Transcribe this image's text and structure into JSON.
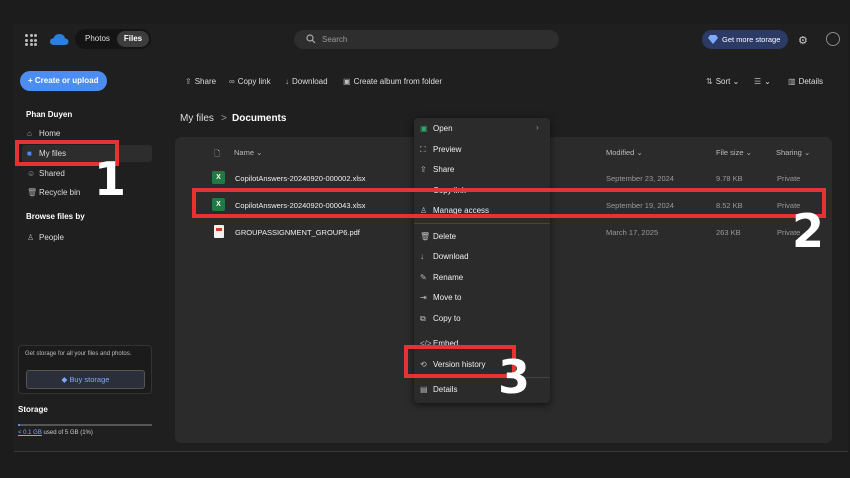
{
  "topbar": {
    "tab_photos": "Photos",
    "tab_files": "Files",
    "search_placeholder": "Search",
    "more_storage": "Get more storage",
    "icons": [
      "app-launcher-icon",
      "onedrive-cloud-icon",
      "search-icon",
      "diamond-icon",
      "gear-icon"
    ],
    "accent": "#4b8df0"
  },
  "sidebar": {
    "create_label": "Create or upload",
    "user_name": "Phan Duyen",
    "items": [
      {
        "label": "Home",
        "icon": "home-icon"
      },
      {
        "label": "My files",
        "icon": "folder-icon",
        "active": true
      },
      {
        "label": "Shared",
        "icon": "shared-people-icon"
      },
      {
        "label": "Recycle bin",
        "icon": "trash-icon"
      }
    ],
    "browse_heading": "Browse files by",
    "browse_items": [
      {
        "label": "People",
        "icon": "person-icon"
      }
    ],
    "promo_text": "Get storage for all your files and photos.",
    "buy_storage": "Buy storage",
    "storage_title": "Storage",
    "storage_used_link": "< 0.1 GB",
    "storage_used_rest": " used of 5 GB (1%)",
    "storage_fraction": 0.01
  },
  "toolbar": {
    "share": "Share",
    "copy_link": "Copy link",
    "download": "Download",
    "create_album": "Create album from folder",
    "sort": "Sort",
    "details": "Details"
  },
  "breadcrumb": {
    "root": "My files",
    "separator": ">",
    "current": "Documents"
  },
  "table": {
    "headers": {
      "name": "Name",
      "modified": "Modified",
      "size": "File size",
      "sharing": "Sharing"
    },
    "rows": [
      {
        "name": "CopilotAnswers-20240920-000002.xlsx",
        "modified": "September 23, 2024",
        "size": "9.78 KB",
        "sharing": "Private",
        "type": "excel"
      },
      {
        "name": "CopilotAnswers-20240920-000043.xlsx",
        "modified": "September 19, 2024",
        "size": "8.52 KB",
        "sharing": "Private",
        "type": "excel"
      },
      {
        "name": "GROUPASSIGNMENT_GROUP6.pdf",
        "modified": "March 17, 2025",
        "size": "263 KB",
        "sharing": "Private",
        "type": "pdf"
      }
    ]
  },
  "context_menu": {
    "items": [
      {
        "label": "Open",
        "icon": "excel-icon"
      },
      {
        "label": "Preview",
        "icon": "preview-icon"
      },
      {
        "label": "Share",
        "icon": "share-icon"
      },
      {
        "label": "Copy link",
        "icon": "link-icon"
      },
      {
        "label": "Manage access",
        "icon": "person-icon"
      },
      {
        "label": "Delete",
        "icon": "trash-icon"
      },
      {
        "label": "Download",
        "icon": "download-icon"
      },
      {
        "label": "Rename",
        "icon": "rename-icon"
      },
      {
        "label": "Move to",
        "icon": "move-icon"
      },
      {
        "label": "Copy to",
        "icon": "copy-icon"
      },
      {
        "label": "Embed",
        "icon": "embed-icon"
      },
      {
        "label": "Version history",
        "icon": "history-icon"
      },
      {
        "label": "Details",
        "icon": "details-icon"
      }
    ]
  },
  "annotations": {
    "step1": "1",
    "step2": "2",
    "step3": "3",
    "color": "#e63232"
  }
}
